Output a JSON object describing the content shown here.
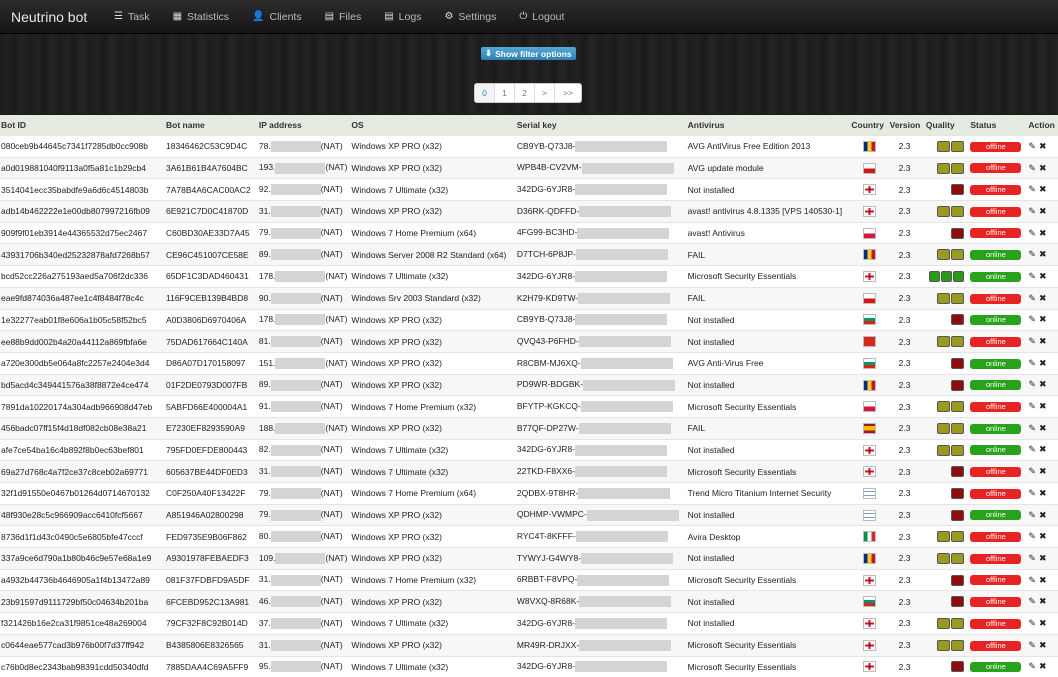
{
  "app": {
    "brand": "Neutrino bot",
    "nav": [
      {
        "label": "Task",
        "icon": "list-icon"
      },
      {
        "label": "Statistics",
        "icon": "stats-icon"
      },
      {
        "label": "Clients",
        "icon": "user-icon"
      },
      {
        "label": "Files",
        "icon": "file-icon"
      },
      {
        "label": "Logs",
        "icon": "logs-icon"
      },
      {
        "label": "Settings",
        "icon": "gear-icon"
      },
      {
        "label": "Logout",
        "icon": "power-icon"
      }
    ],
    "filter_button": "Show filter options",
    "pagination": [
      "0",
      "1",
      "2",
      ">",
      ">>"
    ],
    "current_page": "0"
  },
  "table": {
    "headers": [
      "Bot ID",
      "Bot name",
      "IP address",
      "OS",
      "Serial key",
      "Antivirus",
      "Country",
      "Version",
      "Quality",
      "Status",
      "Action"
    ],
    "rows": [
      {
        "id": "080ceb9b44645c7341f7285db0cc908b",
        "name": "18346462C53C9D4C",
        "ip": "78.",
        "nat": "(NAT)",
        "os": "Windows XP PRO (x32)",
        "serial": "CB9YB-Q73J8-",
        "av": "AVG AntiVirus Free Edition 2013",
        "country": "RO",
        "version": "2.3",
        "quality": "olive2",
        "status": "offline"
      },
      {
        "id": "a0d019881040f9113a0f5a81c1b29cb4",
        "name": "3A61B61B4A7604BC",
        "ip": "193.",
        "nat": "(NAT)",
        "os": "Windows XP PRO (x32)",
        "serial": "WPB4B-CV2VM-",
        "av": "AVG update module",
        "country": "CZ",
        "version": "2.3",
        "quality": "olive2",
        "status": "offline"
      },
      {
        "id": "3514041ecc35babdfe9a6d6c4514803b",
        "name": "7A78B4A6CAC00AC2",
        "ip": "92.",
        "nat": "(NAT)",
        "os": "Windows 7 Ultimate (x32)",
        "serial": "342DG-6YJR8-",
        "av": "Not installed",
        "country": "GB",
        "version": "2.3",
        "quality": "red",
        "status": "offline"
      },
      {
        "id": "adb14b462222e1e00db807997216fb09",
        "name": "6E921C7D0C41870D",
        "ip": "31.",
        "nat": "(NAT)",
        "os": "Windows XP PRO (x32)",
        "serial": "D36RK-QDFFD-",
        "av": "avast! antivirus 4.8.1335 [VPS 140530-1]",
        "country": "GB",
        "version": "2.3",
        "quality": "olive2",
        "status": "offline"
      },
      {
        "id": "909f9f01eb3914e44365532d75ec2467",
        "name": "C60BD30AE33D7A45",
        "ip": "79.",
        "nat": "(NAT)",
        "os": "Windows 7 Home Premium (x64)",
        "serial": "4FG99-BC3HD-",
        "av": "avast! Antivirus",
        "country": "PL",
        "version": "2.3",
        "quality": "red",
        "status": "offline"
      },
      {
        "id": "43931706b340ed25232878afd7268b57",
        "name": "CE96C451007CE58E",
        "ip": "89.",
        "nat": "(NAT)",
        "os": "Windows Server 2008 R2 Standard (x64)",
        "serial": "D7TCH-6P8JP-",
        "av": "FAIL",
        "country": "RO",
        "version": "2.3",
        "quality": "olive2",
        "status": "online"
      },
      {
        "id": "bcd52cc226a275193aed5a706f2dc336",
        "name": "65DF1C3DAD460431",
        "ip": "178.",
        "nat": "(NAT)",
        "os": "Windows 7 Ultimate (x32)",
        "serial": "342DG-6YJR8-",
        "av": "Microsoft Security Essentials",
        "country": "GB",
        "version": "2.3",
        "quality": "green3",
        "status": "online"
      },
      {
        "id": "eae9fd874036a487ee1c4f8484f78c4c",
        "name": "116F9CEB139B4BD8",
        "ip": "90.",
        "nat": "(NAT)",
        "os": "Windows Srv 2003 Standard (x32)",
        "serial": "K2H79-KD9TW-",
        "av": "FAIL",
        "country": "CZ",
        "version": "2.3",
        "quality": "olive2",
        "status": "offline"
      },
      {
        "id": "1e32277eab01f8e606a1b05c58f52bc5",
        "name": "A0D3806D6970406A",
        "ip": "178.",
        "nat": "(NAT)",
        "os": "Windows XP PRO (x32)",
        "serial": "CB9YB-Q73J8-",
        "av": "Not installed",
        "country": "BG",
        "version": "2.3",
        "quality": "red",
        "status": "online"
      },
      {
        "id": "ee88b9dd002b4a20a44112a869fbfa6e",
        "name": "75DAD617664C140A",
        "ip": "81.",
        "nat": "(NAT)",
        "os": "Windows XP PRO (x32)",
        "serial": "QVQ43-P6FHD-",
        "av": "Not installed",
        "country": "CH",
        "version": "2.3",
        "quality": "olive2",
        "status": "offline"
      },
      {
        "id": "a720e300db5e064a8fc2257e2404e3d4",
        "name": "D86A07D170158097",
        "ip": "151.",
        "nat": "(NAT)",
        "os": "Windows XP PRO (x32)",
        "serial": "R8CBM-MJ6XQ-",
        "av": "AVG Anti-Virus Free",
        "country": "BG",
        "version": "2.3",
        "quality": "red",
        "status": "online"
      },
      {
        "id": "bd5acd4c349441576a38f8872e4ce474",
        "name": "01F2DE0793D007FB",
        "ip": "89.",
        "nat": "(NAT)",
        "os": "Windows XP PRO (x32)",
        "serial": "PD9WR-BDGBK-",
        "av": "Not installed",
        "country": "RO",
        "version": "2.3",
        "quality": "red",
        "status": "online"
      },
      {
        "id": "7891da10220174a304adb966908d47eb",
        "name": "5ABFD66E400004A1",
        "ip": "91.",
        "nat": "(NAT)",
        "os": "Windows 7 Home Premium (x32)",
        "serial": "BFYTP-KGKCQ-",
        "av": "Microsoft Security Essentials",
        "country": "PL",
        "version": "2.3",
        "quality": "olive2",
        "status": "offline"
      },
      {
        "id": "456badc07ff15f4d18df082cb08e38a21",
        "name": "E7230EF8293590A9",
        "ip": "188.",
        "nat": "(NAT)",
        "os": "Windows XP PRO (x32)",
        "serial": "B77QF-DP27W-",
        "av": "FAIL",
        "country": "ES",
        "version": "2.3",
        "quality": "olive2",
        "status": "online"
      },
      {
        "id": "afe7ce54ba16c4b892f8b0ec63bef801",
        "name": "795FD0EFDE800443",
        "ip": "82.",
        "nat": "(NAT)",
        "os": "Windows 7 Ultimate (x32)",
        "serial": "342DG-6YJR8-",
        "av": "Not installed",
        "country": "GB",
        "version": "2.3",
        "quality": "olive2",
        "status": "online"
      },
      {
        "id": "69a27d768c4a7f2ce37c8ceb02a69771",
        "name": "605637BE44DF0ED3",
        "ip": "31.",
        "nat": "(NAT)",
        "os": "Windows 7 Ultimate (x32)",
        "serial": "22TKD-F8XX6-",
        "av": "Microsoft Security Essentials",
        "country": "GB",
        "version": "2.3",
        "quality": "red",
        "status": "offline"
      },
      {
        "id": "32f1d91550e0467b01264d0714670132",
        "name": "C0F250A40F13422F",
        "ip": "79.",
        "nat": "(NAT)",
        "os": "Windows 7 Home Premium (x64)",
        "serial": "2QDBX-9T8HR-",
        "av": "Trend Micro Titanium Internet Security",
        "country": "IL",
        "version": "2.3",
        "quality": "red",
        "status": "offline"
      },
      {
        "id": "48f930e28c5c966909acc6410fcf5667",
        "name": "A851946A02800298",
        "ip": "79.",
        "nat": "(NAT)",
        "os": "Windows XP PRO (x32)",
        "serial": "QDHMP-VWMPC-",
        "av": "Not installed",
        "country": "IL",
        "version": "2.3",
        "quality": "red",
        "status": "online"
      },
      {
        "id": "8736d1f1d43c0490c5e6805bfe47cccf",
        "name": "FED9735E9B06F862",
        "ip": "80.",
        "nat": "(NAT)",
        "os": "Windows XP PRO (x32)",
        "serial": "RYC4T-8KFFF-",
        "av": "Avira Desktop",
        "country": "IT",
        "version": "2.3",
        "quality": "olive2",
        "status": "offline"
      },
      {
        "id": "337a9ce6d790a1b80b46c9e57e68a1e9",
        "name": "A9301978FEBAEDF3",
        "ip": "109.",
        "nat": "(NAT)",
        "os": "Windows XP PRO (x32)",
        "serial": "TYWYJ-G4WY8-",
        "av": "Not installed",
        "country": "RO",
        "version": "2.3",
        "quality": "olive2",
        "status": "offline"
      },
      {
        "id": "a4932b44736b4646905a1f4b13472a89",
        "name": "081F37FDBFD9A5DF",
        "ip": "31.",
        "nat": "(NAT)",
        "os": "Windows 7 Home Premium (x32)",
        "serial": "6RBBT-F8VPQ-",
        "av": "Microsoft Security Essentials",
        "country": "GB",
        "version": "2.3",
        "quality": "red",
        "status": "offline"
      },
      {
        "id": "23b91597d9111729bf50c04634b201ba",
        "name": "6FCEBD952C13A981",
        "ip": "46.",
        "nat": "(NAT)",
        "os": "Windows XP PRO (x32)",
        "serial": "W8VXQ-8R68K-",
        "av": "Not installed",
        "country": "BG",
        "version": "2.3",
        "quality": "red",
        "status": "offline"
      },
      {
        "id": "f321426b16e2ca31f9851ce48a269004",
        "name": "79CF32F8C92B014D",
        "ip": "37.",
        "nat": "(NAT)",
        "os": "Windows 7 Ultimate (x32)",
        "serial": "342DG-6YJR8-",
        "av": "Not installed",
        "country": "GB",
        "version": "2.3",
        "quality": "olive2",
        "status": "offline"
      },
      {
        "id": "c0644eae577cad3b976b00f7d37ff942",
        "name": "B4385806E8326565",
        "ip": "31.",
        "nat": "(NAT)",
        "os": "Windows XP PRO (x32)",
        "serial": "MR49R-DRJXX-",
        "av": "Microsoft Security Essentials",
        "country": "GB",
        "version": "2.3",
        "quality": "olive2",
        "status": "offline"
      },
      {
        "id": "c76b0d8ec2343bab98391cdd50340dfd",
        "name": "7885DAA4C69A5FF9",
        "ip": "95.",
        "nat": "(NAT)",
        "os": "Windows 7 Ultimate (x32)",
        "serial": "342DG-6YJR8-",
        "av": "Microsoft Security Essentials",
        "country": "GB",
        "version": "2.3",
        "quality": "red",
        "status": "online"
      }
    ]
  },
  "colors": {
    "online": "#27a21a",
    "offline": "#e82323",
    "quality_olive": "#9a9a1e",
    "quality_red": "#8b0d0d",
    "quality_green": "#2a9a18"
  }
}
